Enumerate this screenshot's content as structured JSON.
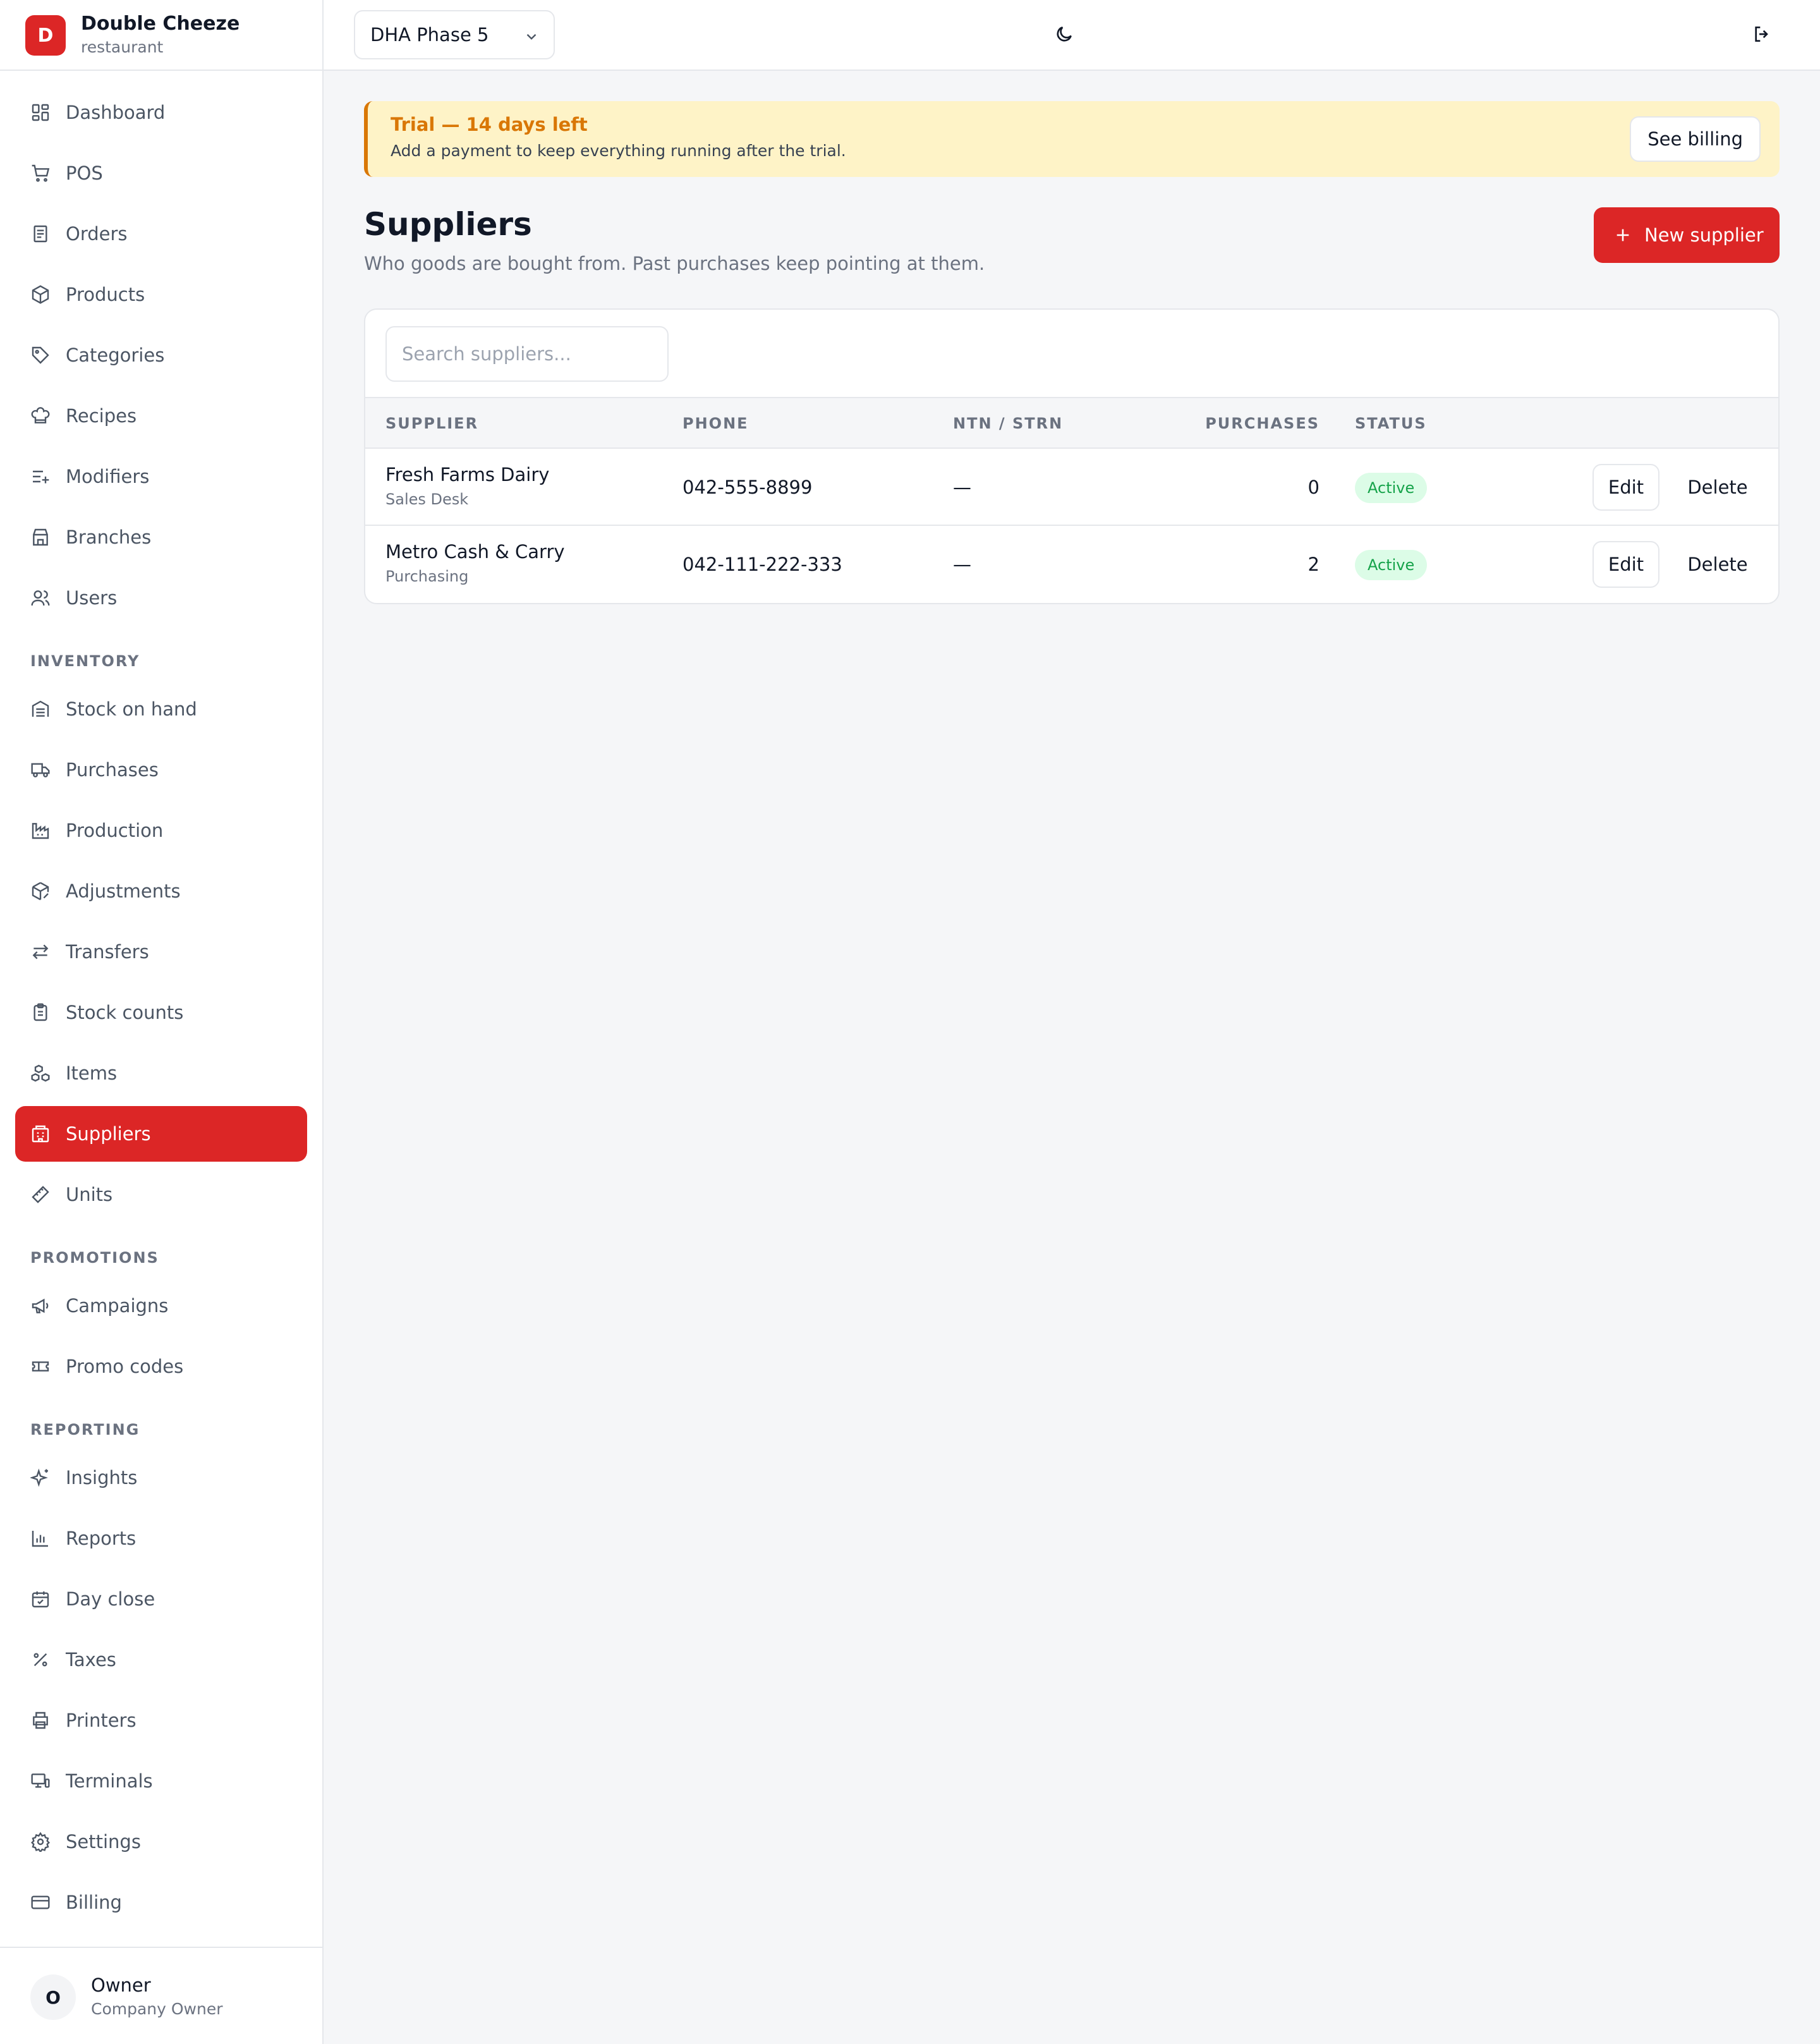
{
  "brand": {
    "initial": "D",
    "name": "Double Cheeze",
    "subtitle": "restaurant"
  },
  "sidebar": {
    "main_items": [
      {
        "label": "Dashboard",
        "icon": "dashboard-icon"
      },
      {
        "label": "POS",
        "icon": "cart-icon"
      },
      {
        "label": "Orders",
        "icon": "receipt-icon"
      },
      {
        "label": "Products",
        "icon": "box-icon"
      },
      {
        "label": "Categories",
        "icon": "tag-icon"
      },
      {
        "label": "Recipes",
        "icon": "chef-hat-icon"
      },
      {
        "label": "Modifiers",
        "icon": "list-plus-icon"
      },
      {
        "label": "Branches",
        "icon": "store-icon"
      },
      {
        "label": "Users",
        "icon": "users-icon"
      }
    ],
    "inventory_heading": "INVENTORY",
    "inventory_items": [
      {
        "label": "Stock on hand",
        "icon": "warehouse-icon"
      },
      {
        "label": "Purchases",
        "icon": "truck-icon"
      },
      {
        "label": "Production",
        "icon": "factory-icon"
      },
      {
        "label": "Adjustments",
        "icon": "package-edit-icon"
      },
      {
        "label": "Transfers",
        "icon": "arrows-left-right-icon"
      },
      {
        "label": "Stock counts",
        "icon": "clipboard-list-icon"
      },
      {
        "label": "Items",
        "icon": "boxes-icon"
      },
      {
        "label": "Suppliers",
        "icon": "building-icon",
        "active": true
      },
      {
        "label": "Units",
        "icon": "ruler-icon"
      }
    ],
    "promotions_heading": "PROMOTIONS",
    "promotions_items": [
      {
        "label": "Campaigns",
        "icon": "megaphone-icon"
      },
      {
        "label": "Promo codes",
        "icon": "ticket-icon"
      }
    ],
    "reporting_heading": "REPORTING",
    "reporting_items": [
      {
        "label": "Insights",
        "icon": "sparkles-icon"
      },
      {
        "label": "Reports",
        "icon": "bar-chart-icon"
      },
      {
        "label": "Day close",
        "icon": "calendar-check-icon"
      },
      {
        "label": "Taxes",
        "icon": "percent-icon"
      },
      {
        "label": "Printers",
        "icon": "printer-icon"
      },
      {
        "label": "Terminals",
        "icon": "monitor-icon"
      },
      {
        "label": "Settings",
        "icon": "gear-icon"
      },
      {
        "label": "Billing",
        "icon": "credit-card-icon"
      }
    ]
  },
  "user": {
    "initial": "O",
    "name": "Owner",
    "role": "Company Owner"
  },
  "topbar": {
    "branch": "DHA Phase 5",
    "theme_icon": "moon-icon",
    "logout_icon": "logout-icon"
  },
  "trial": {
    "title": "Trial — 14 days left",
    "subtitle": "Add a payment to keep everything running after the trial.",
    "button": "See billing"
  },
  "page": {
    "title": "Suppliers",
    "subtitle": "Who goods are bought from. Past purchases keep pointing at them.",
    "new_button": "New supplier"
  },
  "table": {
    "search_placeholder": "Search suppliers...",
    "headers": {
      "supplier": "SUPPLIER",
      "phone": "PHONE",
      "ntn": "NTN / STRN",
      "purchases": "PURCHASES",
      "status": "STATUS"
    },
    "rows": [
      {
        "name": "Fresh Farms Dairy",
        "contact": "Sales Desk",
        "phone": "042-555-8899",
        "ntn": "—",
        "purchases": "0",
        "status": "Active",
        "edit": "Edit",
        "delete": "Delete"
      },
      {
        "name": "Metro Cash & Carry",
        "contact": "Purchasing",
        "phone": "042-111-222-333",
        "ntn": "—",
        "purchases": "2",
        "status": "Active",
        "edit": "Edit",
        "delete": "Delete"
      }
    ]
  },
  "colors": {
    "accent": "#dc2626",
    "trial_bg": "#fef3c7",
    "trial_text": "#d97706",
    "active_badge_bg": "#dcfce7",
    "active_badge_text": "#16a34a"
  }
}
